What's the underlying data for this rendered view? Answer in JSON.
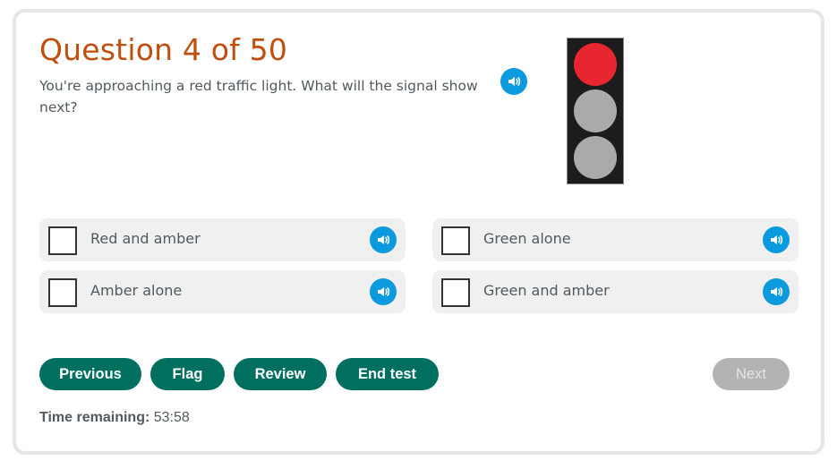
{
  "question": {
    "title": "Question 4 of 50",
    "text": "You're approaching a red traffic light. What will the signal show next?",
    "audio_icon": "speaker-icon"
  },
  "traffic_light": {
    "lamps": [
      {
        "name": "red",
        "lit": true,
        "color": "#e8262f"
      },
      {
        "name": "amber",
        "lit": false,
        "color": "#aaaaaa"
      },
      {
        "name": "green",
        "lit": false,
        "color": "#aaaaaa"
      }
    ],
    "housing_color": "#1c1c1c"
  },
  "answers": [
    {
      "label": "Red and amber",
      "checked": false
    },
    {
      "label": "Green alone",
      "checked": false
    },
    {
      "label": "Amber alone",
      "checked": false
    },
    {
      "label": "Green and amber",
      "checked": false
    }
  ],
  "buttons": {
    "previous": "Previous",
    "flag": "Flag",
    "review": "Review",
    "end_test": "End test",
    "next": "Next",
    "next_enabled": false
  },
  "timer": {
    "label": "Time remaining:",
    "value": "53:58"
  },
  "colors": {
    "title": "#c14e0c",
    "primary_button": "#006f60",
    "disabled_button": "#b3b3b3",
    "audio": "#0b9ade"
  }
}
